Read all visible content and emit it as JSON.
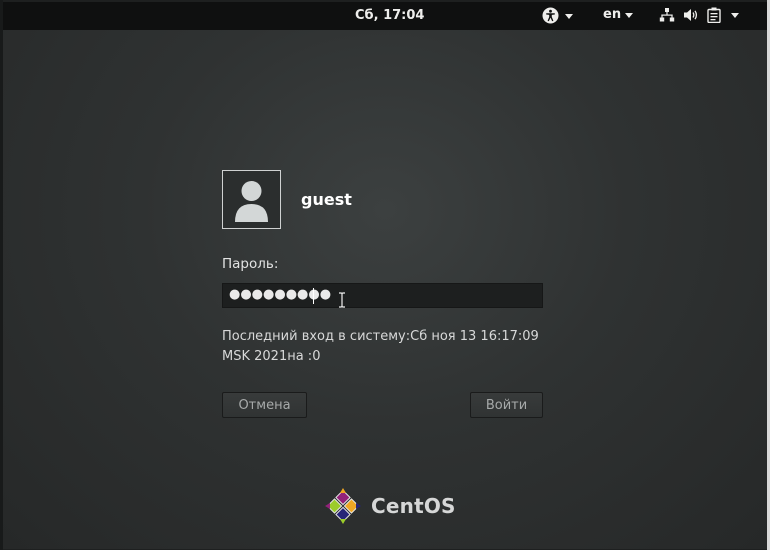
{
  "topbar": {
    "clock": "Сб, 17:04",
    "accessibility_icon": "accessibility-icon",
    "language": "en",
    "icons": [
      "network-icon",
      "volume-icon",
      "power-menu-icon"
    ]
  },
  "login": {
    "username": "guest",
    "password_label": "Пароль:",
    "password_value": "●●●●●●●●●",
    "last_login": "Последний вход в систему:Сб ноя 13 16:17:09\nMSK 2021на :0",
    "cancel_label": "Отмена",
    "login_label": "Войти"
  },
  "branding": {
    "logo_text": "CentOS",
    "logo_colors": [
      "#932279",
      "#efa724",
      "#262577",
      "#9ccd2a"
    ]
  }
}
